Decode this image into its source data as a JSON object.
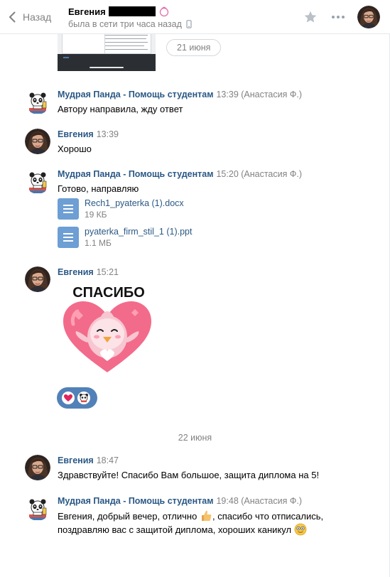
{
  "header": {
    "back_label": "Назад",
    "peer_name": "Евгения",
    "peer_status": "была в сети три часа назад",
    "icons": [
      "back-chevron-icon",
      "star-icon",
      "more-icon",
      "phone-icon",
      "birthday-gift-icon"
    ]
  },
  "dates": {
    "first": "21 июня",
    "second": "22 июня"
  },
  "messages": [
    {
      "author": "Мудрая Панда - Помощь студентам",
      "time": "13:39 (Анастасия Ф.)",
      "text": "Автору направила, жду ответ"
    },
    {
      "author": "Евгения",
      "time": "13:39",
      "text": "Хорошо"
    },
    {
      "author": "Мудрая Панда - Помощь студентам",
      "time": "15:20 (Анастасия Ф.)",
      "text": "Готово, направляю",
      "files": [
        {
          "name": "Rech1_pyaterka (1).docx",
          "size": "19 КБ"
        },
        {
          "name": "pyaterka_firm_stil_1 (1).ppt",
          "size": "1.1 МБ"
        }
      ]
    },
    {
      "author": "Евгения",
      "time": "15:21",
      "sticker_text": "СПАСИБО",
      "reactions": [
        "heart-emoji",
        "panda-emoji"
      ]
    },
    {
      "author": "Евгения",
      "time": "18:47",
      "text": "Здравствуйте! Спасибо Вам большое, защита диплома на 5!"
    },
    {
      "author": "Мудрая Панда - Помощь студентам",
      "time": "19:48 (Анастасия Ф.)",
      "text_line1_a": "Евгения, добрый вечер, отлично",
      "text_line1_b": ", спасибо что отписались,",
      "text_line2": "поздравляю вас с защитой диплома, хороших каникул"
    }
  ],
  "colors": {
    "link": "#2a5885",
    "muted": "#828282",
    "file_icon": "#6d9ed4",
    "reaction_bg": "#5181b8",
    "sticker_heart": "#f36b8a"
  }
}
